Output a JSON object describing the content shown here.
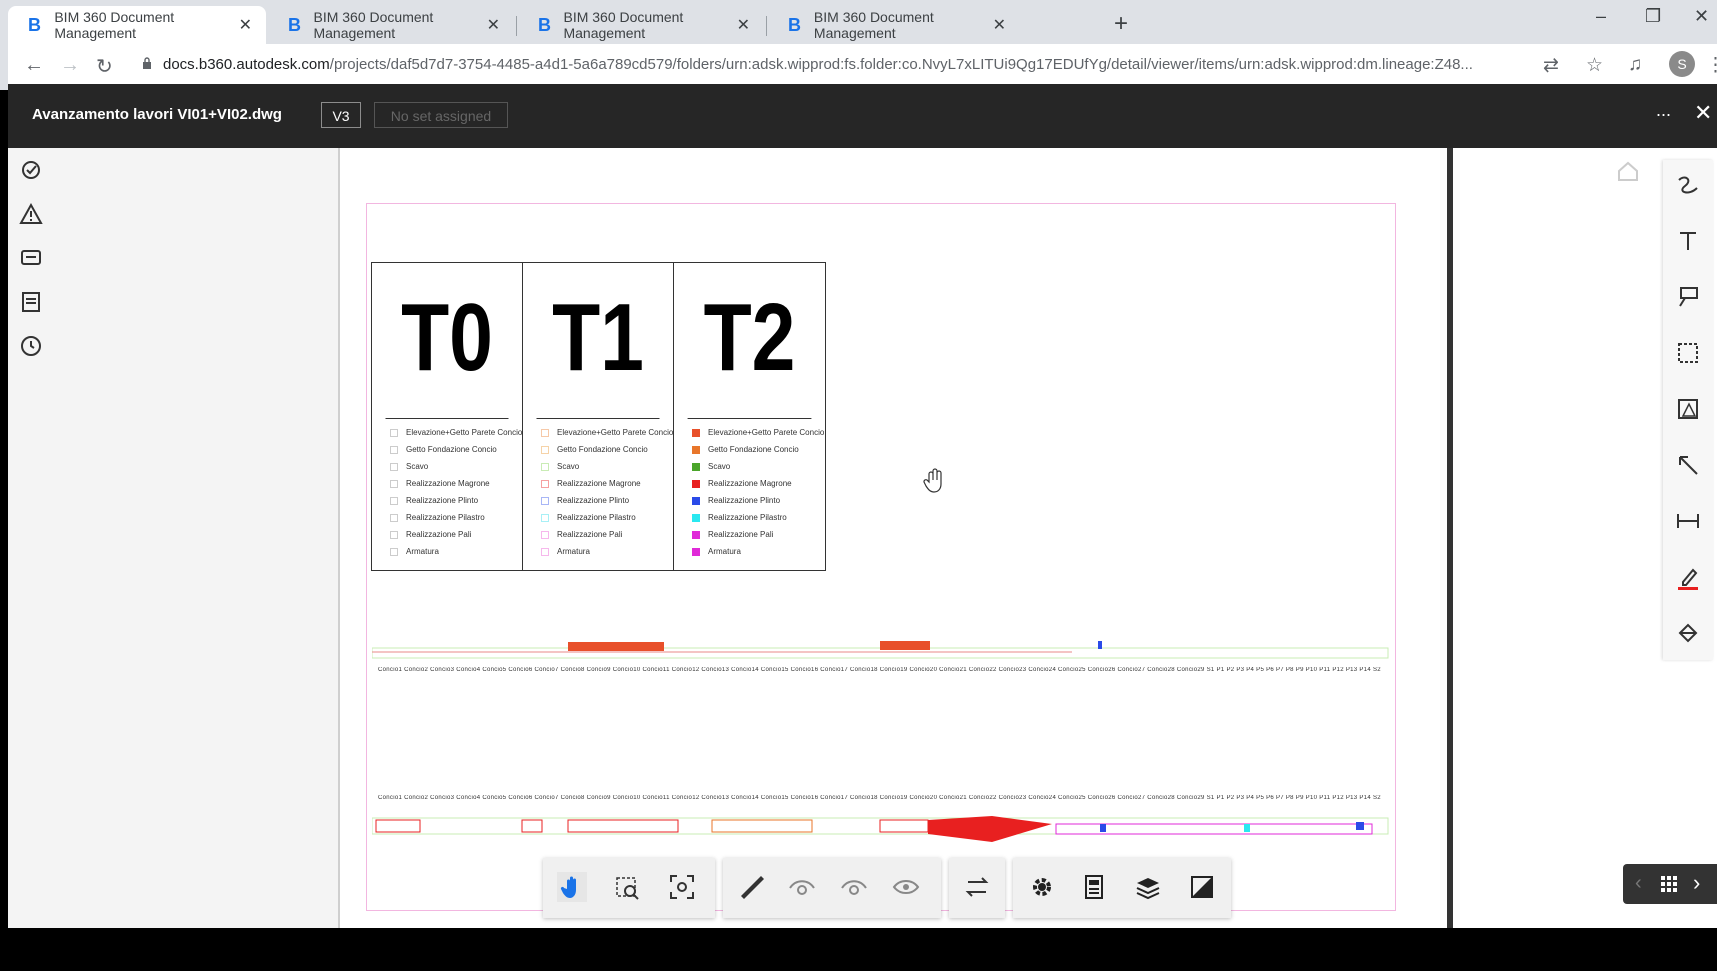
{
  "browser": {
    "tabs": [
      {
        "label": "BIM 360 Document Management",
        "active": true
      },
      {
        "label": "BIM 360 Document Management",
        "active": false
      },
      {
        "label": "BIM 360 Document Management",
        "active": false
      },
      {
        "label": "BIM 360 Document Management",
        "active": false
      }
    ],
    "new_tab_glyph": "+",
    "url_host": "docs.b360.autodesk.com",
    "url_path": "/projects/daf5d7d7-3754-4485-a4d1-5a6a789cd579/folders/urn:adsk.wipprod:fs.folder:co.NvyL7xLITUi9Qg17EDUfYg/detail/viewer/items/urn:adsk.wipprod:dm.lineage:Z48...",
    "profile_initial": "S"
  },
  "app": {
    "doc_title": "Avanzamento lavori VI01+VI02.dwg",
    "version": "V3",
    "set_button": "No set assigned",
    "more_glyph": "...",
    "close_glyph": "✕"
  },
  "left_toolbar": [
    "markup-check-icon",
    "issue-warning-icon",
    "rfi-comment-icon",
    "sheet-list-icon",
    "history-clock-icon"
  ],
  "legend": {
    "columns": [
      {
        "header": "T0"
      },
      {
        "header": "T1"
      },
      {
        "header": "T2"
      }
    ],
    "rows": [
      "Elevazione+Getto Parete Concio",
      "Getto Fondazione Concio",
      "Scavo",
      "Realizzazione Magrone",
      "Realizzazione Plinto",
      "Realizzazione Pilastro",
      "Realizzazione Pali",
      "Armatura"
    ],
    "colors": {
      "T0": [
        "#ffffff",
        "#ffffff",
        "#ffffff",
        "#ffffff",
        "#ffffff",
        "#ffffff",
        "#ffffff",
        "#ffffff"
      ],
      "T1": [
        "#f6c9a8",
        "#f6d3a8",
        "#c9ecb5",
        "#f6a1a1",
        "#a8b6f6",
        "#a8f0f6",
        "#f6b8ec",
        "#f6b8ec"
      ],
      "T2": [
        "#e8502a",
        "#e8762a",
        "#4aa52a",
        "#e82020",
        "#2a4ae8",
        "#2ae8f0",
        "#e02ad8",
        "#e02ad8"
      ]
    }
  },
  "strips": {
    "top_labels": "Concio1 Concio2 Concio3 Concio4 Concio5 Concio6 Concio7 Concio8 Concio9 Concio10 Concio11 Concio12 Concio13 Concio14 Concio15 Concio16 Concio17 Concio18 Concio19 Concio20 Concio21 Concio22 Concio23 Concio24 Concio25 Concio26 Concio27 Concio28   Concio29   S1   P1   P2   P3   P4   P5   P6   P7   P8   P9   P10  P11  P12  P13  P14  S2",
    "bottom_labels": "Concio1 Concio2 Concio3 Concio4 Concio5 Concio6 Concio7 Concio8 Concio9 Concio10 Concio11 Concio12 Concio13 Concio14 Concio15 Concio16 Concio17 Concio18 Concio19 Concio20 Concio21 Concio22 Concio23 Concio24 Concio25 Concio26 Concio27 Concio28   Concio29   S1   P1   P2   P3   P4   P5   P6   P7   P8   P9   P10  P11  P12  P13  P14  S2"
  },
  "bottom_toolbar": {
    "groups": [
      [
        "pan-hand-icon",
        "zoom-window-icon",
        "fit-to-view-icon"
      ],
      [
        "measure-ruler-icon",
        "markup-hide-icon",
        "markup-show-icon",
        "markup-visibility-icon"
      ],
      [
        "compare-arrows-icon"
      ],
      [
        "settings-gear-icon",
        "properties-icon",
        "layers-icon",
        "fullscreen-icon"
      ]
    ]
  },
  "markup_toolbar": [
    "freehand-icon",
    "text-icon",
    "callout-icon",
    "rectangle-icon",
    "cloud-icon",
    "arrow-icon",
    "dimension-icon",
    "pen-color-icon",
    "fill-icon"
  ],
  "sheet_nav": {
    "prev": "‹",
    "grid": "grid-icon",
    "next": "›"
  },
  "colors": {
    "accent": "#1a73e8",
    "appbar": "#262626",
    "strip_red": "#e8502a"
  }
}
